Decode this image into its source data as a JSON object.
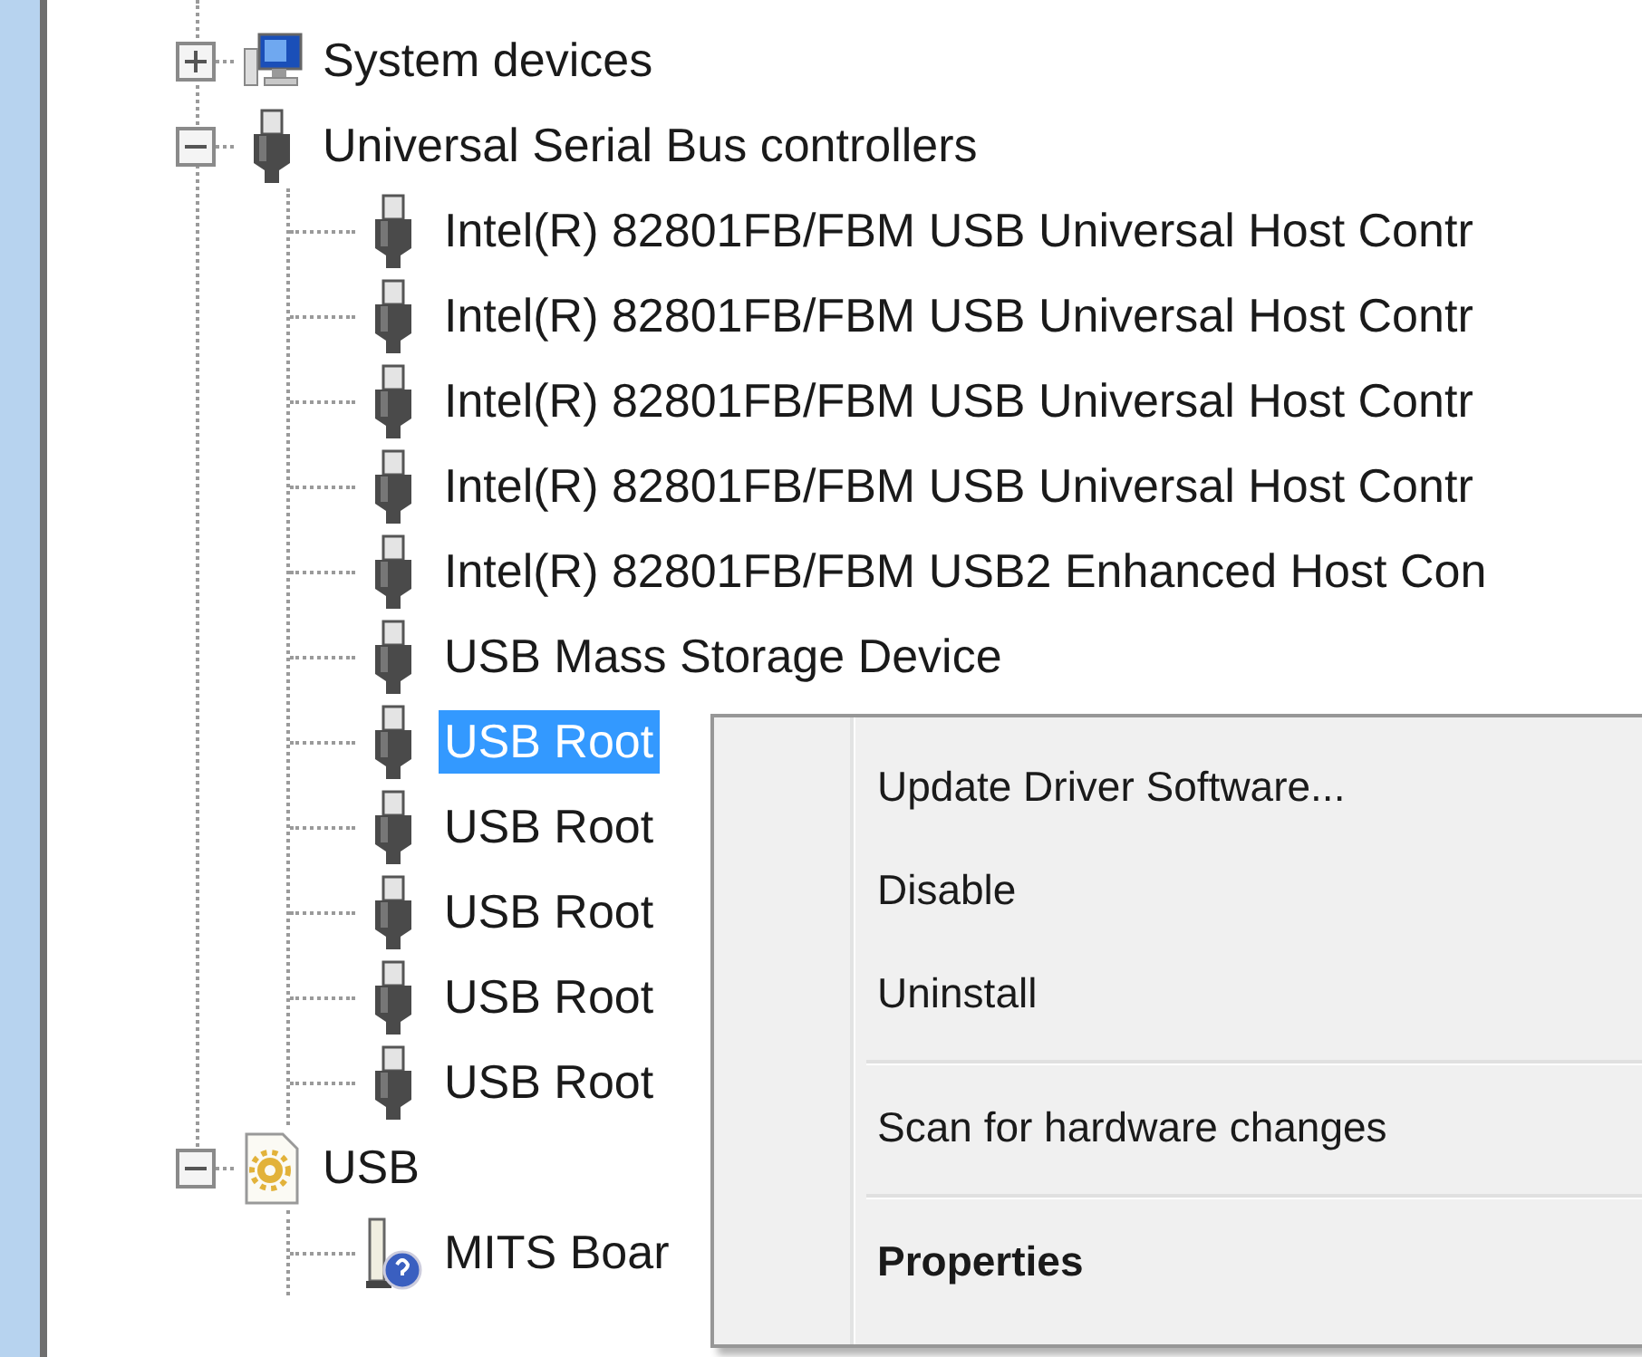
{
  "tree": [
    {
      "label": "System devices",
      "kind": "computer",
      "expanded": false,
      "selected": false
    },
    {
      "label": "Universal Serial Bus controllers",
      "kind": "usb",
      "expanded": true,
      "selected": false,
      "children": [
        {
          "label": "Intel(R) 82801FB/FBM USB Universal Host Contr",
          "kind": "usb",
          "selected": false
        },
        {
          "label": "Intel(R) 82801FB/FBM USB Universal Host Contr",
          "kind": "usb",
          "selected": false
        },
        {
          "label": "Intel(R) 82801FB/FBM USB Universal Host Contr",
          "kind": "usb",
          "selected": false
        },
        {
          "label": "Intel(R) 82801FB/FBM USB Universal Host Contr",
          "kind": "usb",
          "selected": false
        },
        {
          "label": "Intel(R) 82801FB/FBM USB2 Enhanced Host Con",
          "kind": "usb",
          "selected": false
        },
        {
          "label": "USB Mass Storage Device",
          "kind": "usb",
          "selected": false
        },
        {
          "label": "USB Root",
          "kind": "usb",
          "selected": true
        },
        {
          "label": "USB Root",
          "kind": "usb",
          "selected": false
        },
        {
          "label": "USB Root",
          "kind": "usb",
          "selected": false
        },
        {
          "label": "USB Root",
          "kind": "usb",
          "selected": false
        },
        {
          "label": "USB Root",
          "kind": "usb",
          "selected": false
        }
      ]
    },
    {
      "label": "USB",
      "kind": "gear",
      "expanded": true,
      "selected": false,
      "children": [
        {
          "label": "MITS Boar",
          "kind": "unknown",
          "selected": false
        }
      ]
    }
  ],
  "context_menu": {
    "items": [
      {
        "kind": "item",
        "label": "Update Driver Software...",
        "default": false
      },
      {
        "kind": "item",
        "label": "Disable",
        "default": false
      },
      {
        "kind": "item",
        "label": "Uninstall",
        "default": false
      },
      {
        "kind": "separator"
      },
      {
        "kind": "item",
        "label": "Scan for hardware changes",
        "default": false
      },
      {
        "kind": "separator"
      },
      {
        "kind": "item",
        "label": "Properties",
        "default": true
      }
    ]
  }
}
